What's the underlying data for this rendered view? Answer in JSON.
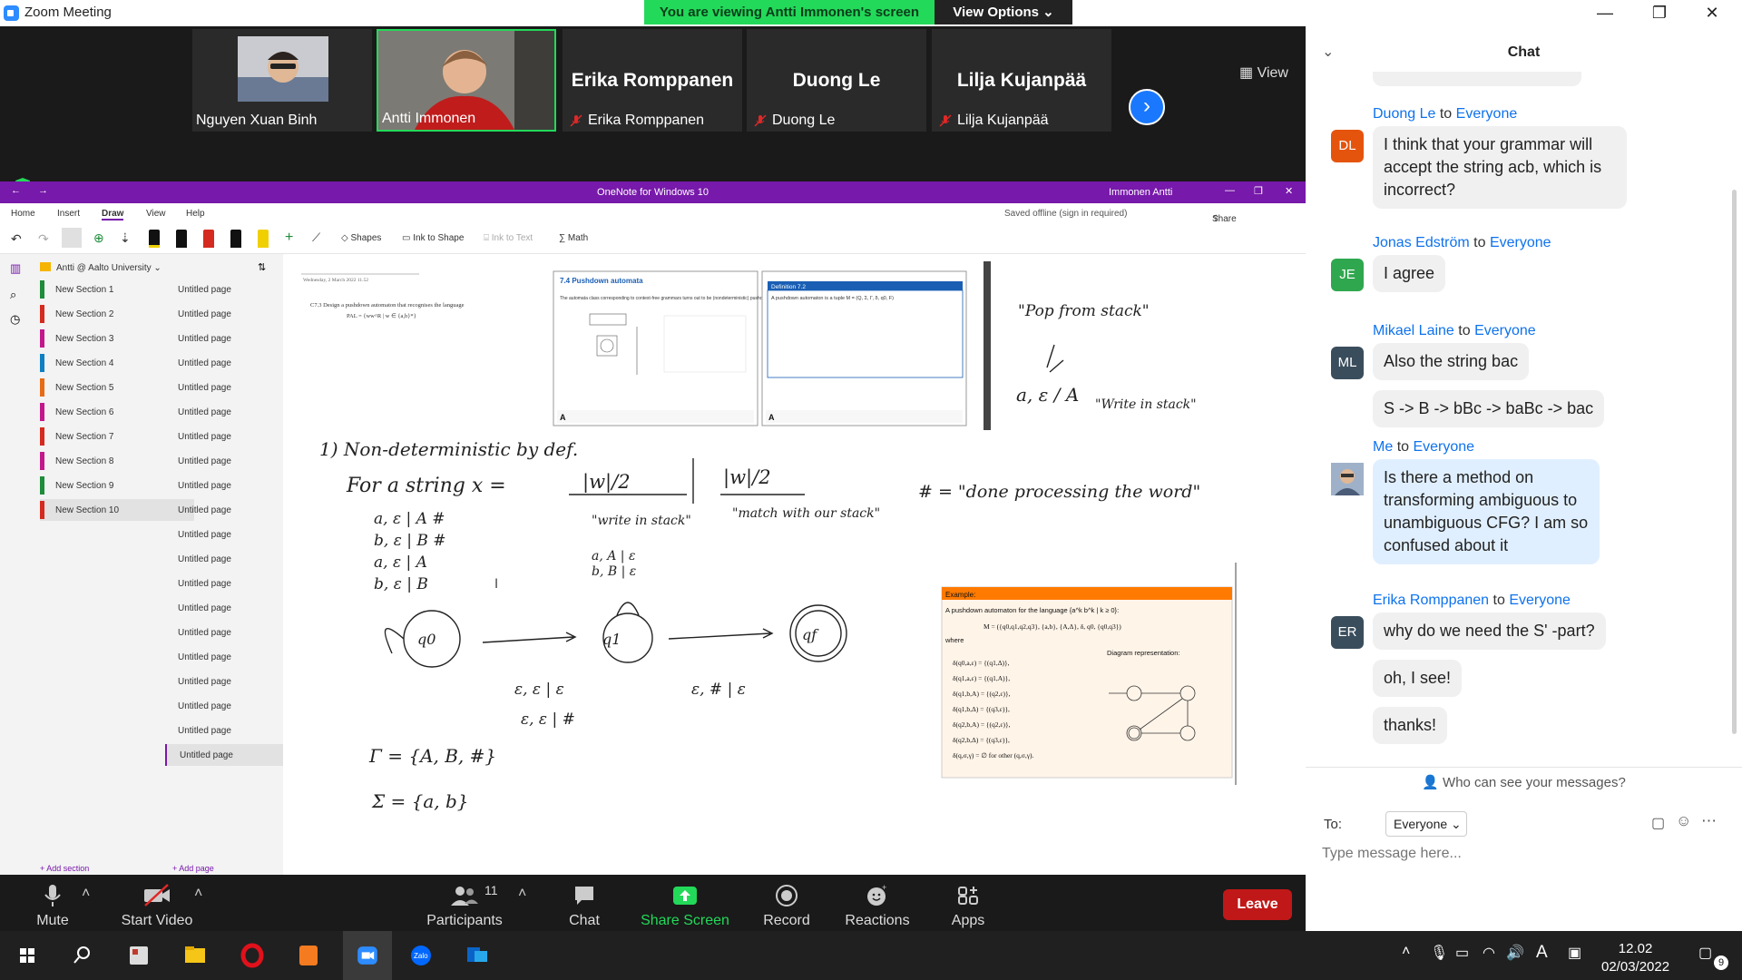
{
  "window": {
    "title": "Zoom Meeting",
    "viewing_banner": "You are viewing Antti Immonen's screen",
    "view_options": "View Options"
  },
  "gallery": {
    "view_label": "View",
    "participants": [
      {
        "name": "Nguyen Xuan Binh",
        "video": true,
        "muted": false
      },
      {
        "name": "Antti Immonen",
        "video": true,
        "muted": false,
        "active": true
      },
      {
        "name": "Erika Romppanen",
        "video": false,
        "muted": true
      },
      {
        "name": "Duong Le",
        "video": false,
        "muted": true
      },
      {
        "name": "Lilja Kujanpää",
        "video": false,
        "muted": true
      }
    ]
  },
  "onenote": {
    "app_title": "OneNote for Windows 10",
    "user": "Immonen Antti",
    "tabs": [
      "Home",
      "Insert",
      "Draw",
      "View",
      "Help"
    ],
    "status": "Saved offline (sign in required)",
    "share": "Share",
    "tools": {
      "shapes": "Shapes",
      "ink_to_shape": "Ink to Shape",
      "ink_to_text": "Ink to Text",
      "math": "Math"
    },
    "notebook": "Antti @ Aalto University",
    "sections": [
      "New Section 1",
      "New Section 2",
      "New Section 3",
      "New Section 4",
      "New Section 5",
      "New Section 6",
      "New Section 7",
      "New Section 8",
      "New Section 9",
      "New Section 10"
    ],
    "section_colors": [
      "#1e8c3a",
      "#d42a1f",
      "#c2188c",
      "#0f7fc2",
      "#e66b17",
      "#c2188c",
      "#d42a1f",
      "#c2188c",
      "#1e8c3a",
      "#d42a1f"
    ],
    "page_label": "Untitled page",
    "page_count": 20,
    "add_section": "+ Add section",
    "add_page": "+ Add page",
    "canvas": {
      "date": "Wednesday, 2 March 2022     11.52",
      "task": "C7.3  Design a pushdown automaton that recognises the language",
      "lang": "PAL = {ww^R | w ∈ {a,b}*}",
      "slide1_title": "7.4 Pushdown automata",
      "slide1_text": "The automata class corresponding to context-free grammars turns out to be (nondeterministic) pushdown automata.",
      "slide2_title": "Definition 7.2",
      "slide2_text": "A pushdown automaton is a tuple  M = (Q, Σ, Γ, δ, q0, F)",
      "hw_pop": "\"Pop from stack\"",
      "hw_a": "a, ε / A",
      "hw_write": "\"Write in stack\"",
      "hw_nondet": "1) Non-deterministic by def.",
      "hw_string": "For a string   x  =",
      "hw_w1": "|w|/2",
      "hw_w2": "|w|/2",
      "hw_write2": "\"write in stack\"",
      "hw_match": "\"match with our stack\"",
      "hw_hash": "#  = \"done processing the word\"",
      "hw_rules": [
        "a, ε | A #",
        "b, ε | B #",
        "a, ε | A",
        "b, ε | B"
      ],
      "hw_loop": "a, A | ε",
      "hw_loop2": "b, B | ε",
      "hw_q0": "q0",
      "hw_q1": "q1",
      "hw_qf": "qf",
      "hw_t1": "ε, ε | ε",
      "hw_t2": "ε, # | ε",
      "hw_t3": "ε, ε | #",
      "hw_gamma": "Γ = {A, B, #}",
      "hw_sigma": "Σ = {a, b}",
      "ex_title": "Example:",
      "ex_text": "A pushdown automaton for the language {a^k b^k | k ≥ 0}:",
      "ex_M": "M = ({q0,q1,q2,q3}, {a,b}, {A,Δ}, δ, q0, {q0,q3})",
      "ex_where": "where",
      "ex_diag": "Diagram representation:",
      "ex_rows": [
        "δ(q0,a,ε) = {(q1,Δ)},",
        "δ(q1,a,ε) = {(q1,A)},",
        "δ(q1,b,A) = {(q2,ε)},",
        "δ(q1,b,Δ) = {(q3,ε)},",
        "δ(q2,b,A) = {(q2,ε)},",
        "δ(q2,b,Δ) = {(q3,ε)},",
        "δ(q,σ,γ) = ∅  for other (q,σ,γ)."
      ]
    }
  },
  "chat": {
    "header": "Chat",
    "messages": [
      {
        "initials": "DL",
        "color": "#e5540d",
        "from": "Duong Le",
        "to": "to",
        "target": "Everyone",
        "texts": [
          "I think that your grammar will accept the string acb, which is incorrect?"
        ]
      },
      {
        "initials": "JE",
        "color": "#2fa74f",
        "from": "Jonas Edström",
        "to": "to",
        "target": "Everyone",
        "texts": [
          "I agree"
        ]
      },
      {
        "initials": "ML",
        "color": "#3a4d5c",
        "from": "Mikael Laine",
        "to": "to",
        "target": "Everyone",
        "texts": [
          "Also the string bac",
          "S -> B -> bBc -> baBc -> bac"
        ]
      },
      {
        "initials": "",
        "color": "#6a7f9a",
        "from": "Me",
        "to": "to",
        "target": "Everyone",
        "texts": [
          "Is there a method on transforming ambiguous to unambiguous CFG? I am so confused about it"
        ]
      },
      {
        "initials": "ER",
        "color": "#3a4d5c",
        "from": "Erika Romppanen",
        "to": "to",
        "target": "Everyone",
        "texts": [
          "why do we need the S' -part?",
          "oh, I see!",
          "thanks!"
        ]
      }
    ],
    "who_can_see": "Who can see your messages?",
    "to_label": "To:",
    "to_value": "Everyone",
    "placeholder": "Type message here..."
  },
  "controls": {
    "mute": "Mute",
    "start_video": "Start Video",
    "participants": "Participants",
    "participant_count": "11",
    "chat": "Chat",
    "share_screen": "Share Screen",
    "record": "Record",
    "reactions": "Reactions",
    "apps": "Apps",
    "leave": "Leave"
  },
  "taskbar": {
    "time": "12.02",
    "date": "02/03/2022",
    "notifications": "9",
    "lang": "A"
  }
}
